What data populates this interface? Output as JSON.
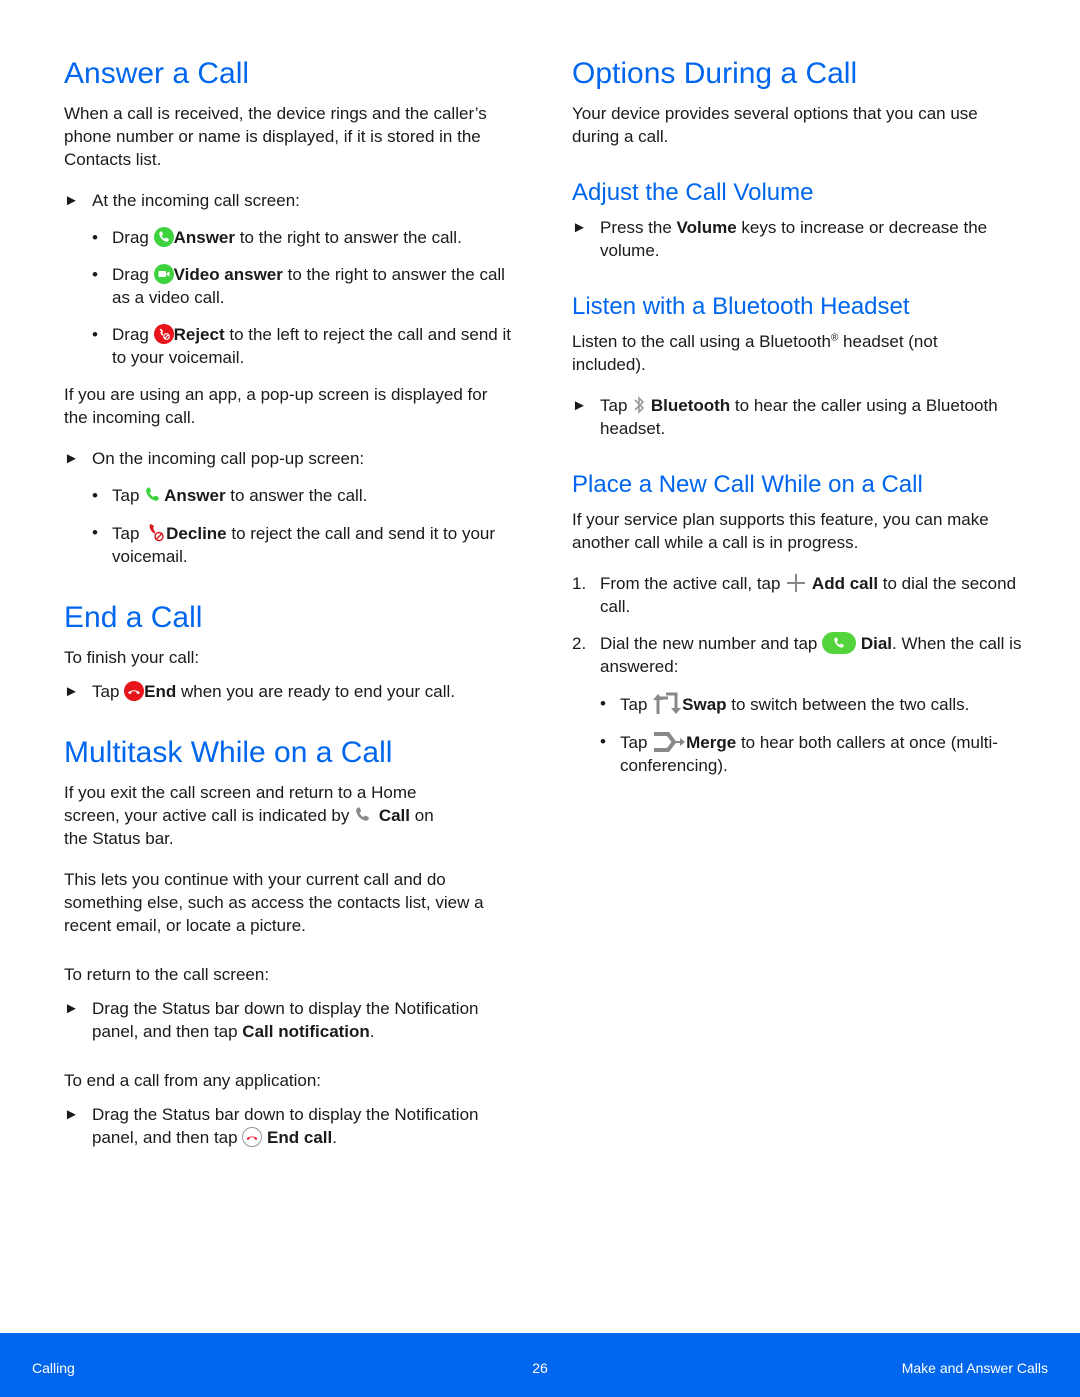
{
  "colors": {
    "heading": "#0066ee",
    "footer_bg": "#0066ee",
    "answer_green": "#3fd23f",
    "reject_red": "#e8141c"
  },
  "left": {
    "answer": {
      "title": "Answer a Call",
      "intro": "When a call is received, the device rings and the caller’s phone number or name is displayed, if it is stored in the Contacts list.",
      "step1": "At the incoming call screen:",
      "bullets1": [
        {
          "pre": "Drag",
          "icon": "answer-phone-icon",
          "bold": "Answer",
          "post": " to the right to answer the call."
        },
        {
          "pre": "Drag",
          "icon": "video-answer-icon",
          "bold": "Video answer",
          "post": " to the right to answer the call as a video call."
        },
        {
          "pre": "Drag",
          "icon": "reject-call-icon",
          "bold": "Reject",
          "post": " to the left to reject the call and send it to your voicemail."
        }
      ],
      "app_note": "If you are using an app, a pop-up screen is displayed for the incoming call.",
      "step2": "On the incoming call pop-up screen:",
      "bullets2": [
        {
          "pre": "Tap",
          "icon": "phone-icon",
          "bold": "Answer",
          "post": " to answer the call."
        },
        {
          "pre": "Tap",
          "icon": "decline-icon",
          "bold": "Decline",
          "post": " to reject the call and send it to your voicemail."
        }
      ]
    },
    "end": {
      "title": "End a Call",
      "intro": "To finish your call:",
      "step": {
        "pre": "Tap",
        "icon": "end-call-icon",
        "bold": "End",
        "post": " when you are ready to end your call."
      }
    },
    "multitask": {
      "title": "Multitask While on a Call",
      "p1_a": "If you exit the call screen and return to a Home screen, your active call is indicated by",
      "p1_bold": "Call",
      "p1_b": " on the Status bar.",
      "p2": "This lets you continue with your current call and do something else, such as access the contacts list, view a recent email, or locate a picture.",
      "p3": "To return to the call screen:",
      "step1_a": "Drag the Status bar down to display the Notification panel, and then tap ",
      "step1_bold": "Call notification",
      "step1_b": ".",
      "p4": "To end a call from any application:",
      "step2_a": "Drag the Status bar down to display the Notification panel, and then tap ",
      "step2_bold": "End call",
      "step2_b": "."
    }
  },
  "right": {
    "options": {
      "title": "Options During a Call",
      "intro": "Your device provides several options that you can use during a call."
    },
    "volume": {
      "title": "Adjust the Call Volume",
      "step_a": "Press the ",
      "step_bold": "Volume",
      "step_b": " keys to increase or decrease the volume."
    },
    "bluetooth": {
      "title": "Listen with a Bluetooth Headset",
      "intro_a": "Listen to the call using a Bluetooth",
      "intro_sup": "®",
      "intro_b": " headset (not included).",
      "step_pre": "Tap ",
      "step_bold": "Bluetooth",
      "step_post": " to hear the caller using a Bluetooth headset."
    },
    "newcall": {
      "title": "Place a New Call While on a Call",
      "intro": "If your service plan supports this feature, you can make another call while a call is in progress.",
      "item1": {
        "num": "1.",
        "pre": "From the active call, tap ",
        "bold": "Add call",
        "post": " to dial the second call."
      },
      "item2": {
        "num": "2.",
        "pre": "Dial the new number and tap ",
        "bold": "Dial",
        "post": ". When the call is answered:"
      },
      "sub": [
        {
          "pre": "Tap ",
          "bold": "Swap",
          "post": " to switch between the two calls."
        },
        {
          "pre": "Tap ",
          "bold": "Merge",
          "post": " to hear both callers at once (multi-conferencing)."
        }
      ]
    }
  },
  "footer": {
    "section": "Calling",
    "page": "26",
    "chapter": "Make and Answer Calls"
  }
}
